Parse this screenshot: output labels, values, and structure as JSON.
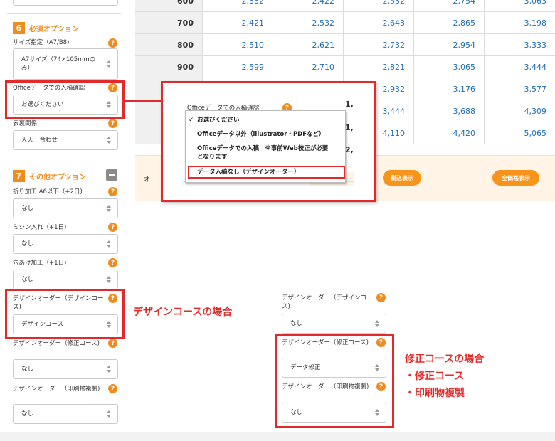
{
  "price_table": {
    "rows": [
      {
        "qty": "600",
        "prices": [
          "2,332",
          "2,422",
          "2,532",
          "2,754",
          "3,063"
        ]
      },
      {
        "qty": "700",
        "prices": [
          "2,421",
          "2,532",
          "2,643",
          "2,865",
          "3,198"
        ]
      },
      {
        "qty": "800",
        "prices": [
          "2,510",
          "2,621",
          "2,732",
          "2,954",
          "3,333"
        ]
      },
      {
        "qty": "900",
        "prices": [
          "2,599",
          "2,710",
          "2,821",
          "3,065",
          "3,444"
        ]
      },
      {
        "qty": "",
        "prices": [
          "",
          "",
          "2,932",
          "3,176",
          "3,577"
        ]
      },
      {
        "qty": "",
        "prices": [
          "",
          "",
          "3,444",
          "3,688",
          "4,309"
        ]
      },
      {
        "qty": "",
        "prices": [
          "",
          "",
          "4,110",
          "4,420",
          "5,065"
        ]
      }
    ]
  },
  "bottom_bar": {
    "label": "オー",
    "tax_button": "税込表示",
    "all_price_button": "全価格表示"
  },
  "sidebar": {
    "section6": {
      "number": "6",
      "title": "必須オプション"
    },
    "size": {
      "label": "サイズ指定（A7/B8)",
      "value": "A7サイズ（74×105mmのみ）"
    },
    "office_entry": {
      "label": "Officeデータでの入稿確認",
      "value": "お選びください"
    },
    "cover": {
      "label": "表裏関係",
      "value": "天天　合わせ"
    },
    "section7": {
      "number": "7",
      "title": "その他オプション"
    },
    "fold": {
      "label": "折り加工 A6以下（+2日)",
      "value": "なし"
    },
    "perforation": {
      "label": "ミシン入れ（+1日)",
      "value": "なし"
    },
    "hole": {
      "label": "穴あけ加工（+1日)",
      "value": "なし"
    },
    "design_course": {
      "label": "デザインオーダー（デザインコース)",
      "value": "デザインコース"
    },
    "fix_course": {
      "label": "デザインオーダー（修正コース)",
      "value": "なし"
    },
    "print_copy": {
      "label": "デザインオーダー（印刷物複製)",
      "value": "なし"
    }
  },
  "popup": {
    "label": "Officeデータでの入稿確認",
    "menu_items": [
      "お選びください",
      "Officeデータ以外（illustrator・PDFなど）",
      "Officeデータでの入稿　※事前Web校正が必要",
      "となります",
      "データ入稿なし（デザインオーダー）"
    ],
    "partial_values": [
      "1,",
      "1,",
      "2,"
    ]
  },
  "design_case_example": {
    "design_course": {
      "label": "デザインオーダー（デザインコース)",
      "value": "なし"
    },
    "fix_course": {
      "label": "デザインオーダー（修正コース)",
      "value": "データ修正"
    },
    "print_copy": {
      "label": "デザインオーダー（印刷物複製)",
      "value": "なし"
    }
  },
  "annotations": {
    "design_course_case": "デザインコースの場合",
    "fix_course_case": "修正コースの場合",
    "bullet_fix": "・修正コース",
    "bullet_print": "・印刷物複製"
  },
  "help_icon_glyph": "?",
  "colors": {
    "accent_orange": "#f08c1e",
    "highlight_red": "#e22a2a",
    "price_blue": "#1f6bb5"
  }
}
